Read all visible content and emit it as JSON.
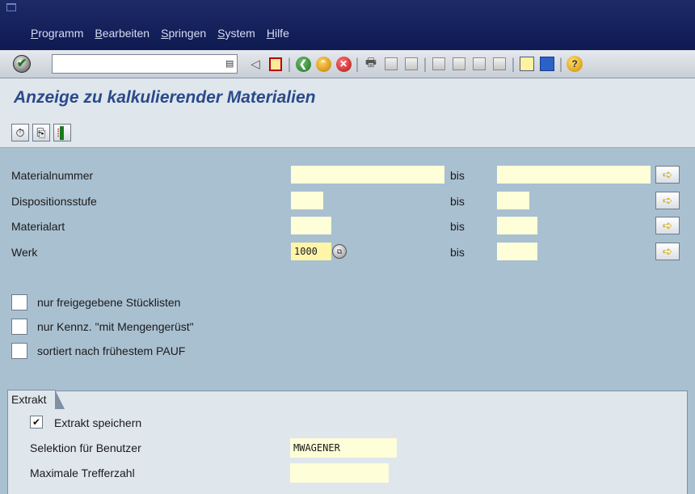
{
  "menu": {
    "items": [
      "Programm",
      "Bearbeiten",
      "Springen",
      "System",
      "Hilfe"
    ]
  },
  "toolbar": {
    "command_value": "",
    "icons": [
      "back-icon",
      "save-icon",
      "back-green-icon",
      "exit-yellow-icon",
      "cancel-red-icon",
      "print-icon",
      "find-icon",
      "find-next-icon",
      "first-page-icon",
      "previous-page-icon",
      "next-page-icon",
      "last-page-icon",
      "create-session-icon",
      "shortcut-icon",
      "help-icon"
    ]
  },
  "page": {
    "title": "Anzeige zu kalkulierender Materialien"
  },
  "selection": {
    "bis_label": "bis",
    "rows": [
      {
        "label": "Materialnummer",
        "from": "",
        "to": ""
      },
      {
        "label": "Dispositionsstufe",
        "from": "",
        "to": ""
      },
      {
        "label": "Materialart",
        "from": "",
        "to": ""
      },
      {
        "label": "Werk",
        "from": "1000",
        "to": ""
      }
    ]
  },
  "options": [
    {
      "label": "nur freigegebene Stücklisten",
      "checked": false
    },
    {
      "label": "nur Kennz. \"mit Mengengerüst\"",
      "checked": false
    },
    {
      "label": "sortiert nach frühestem PAUF",
      "checked": false
    }
  ],
  "extrakt": {
    "tab_label": "Extrakt",
    "save_label": "Extrakt speichern",
    "save_checked": true,
    "user_label": "Selektion für Benutzer",
    "user_value": "MWAGENER",
    "max_label": "Maximale Trefferzahl",
    "max_value": ""
  },
  "colors": {
    "menubar": "#13205a",
    "background": "#a9c0d1",
    "title": "#2a4a8a",
    "input": "#fefed8"
  }
}
